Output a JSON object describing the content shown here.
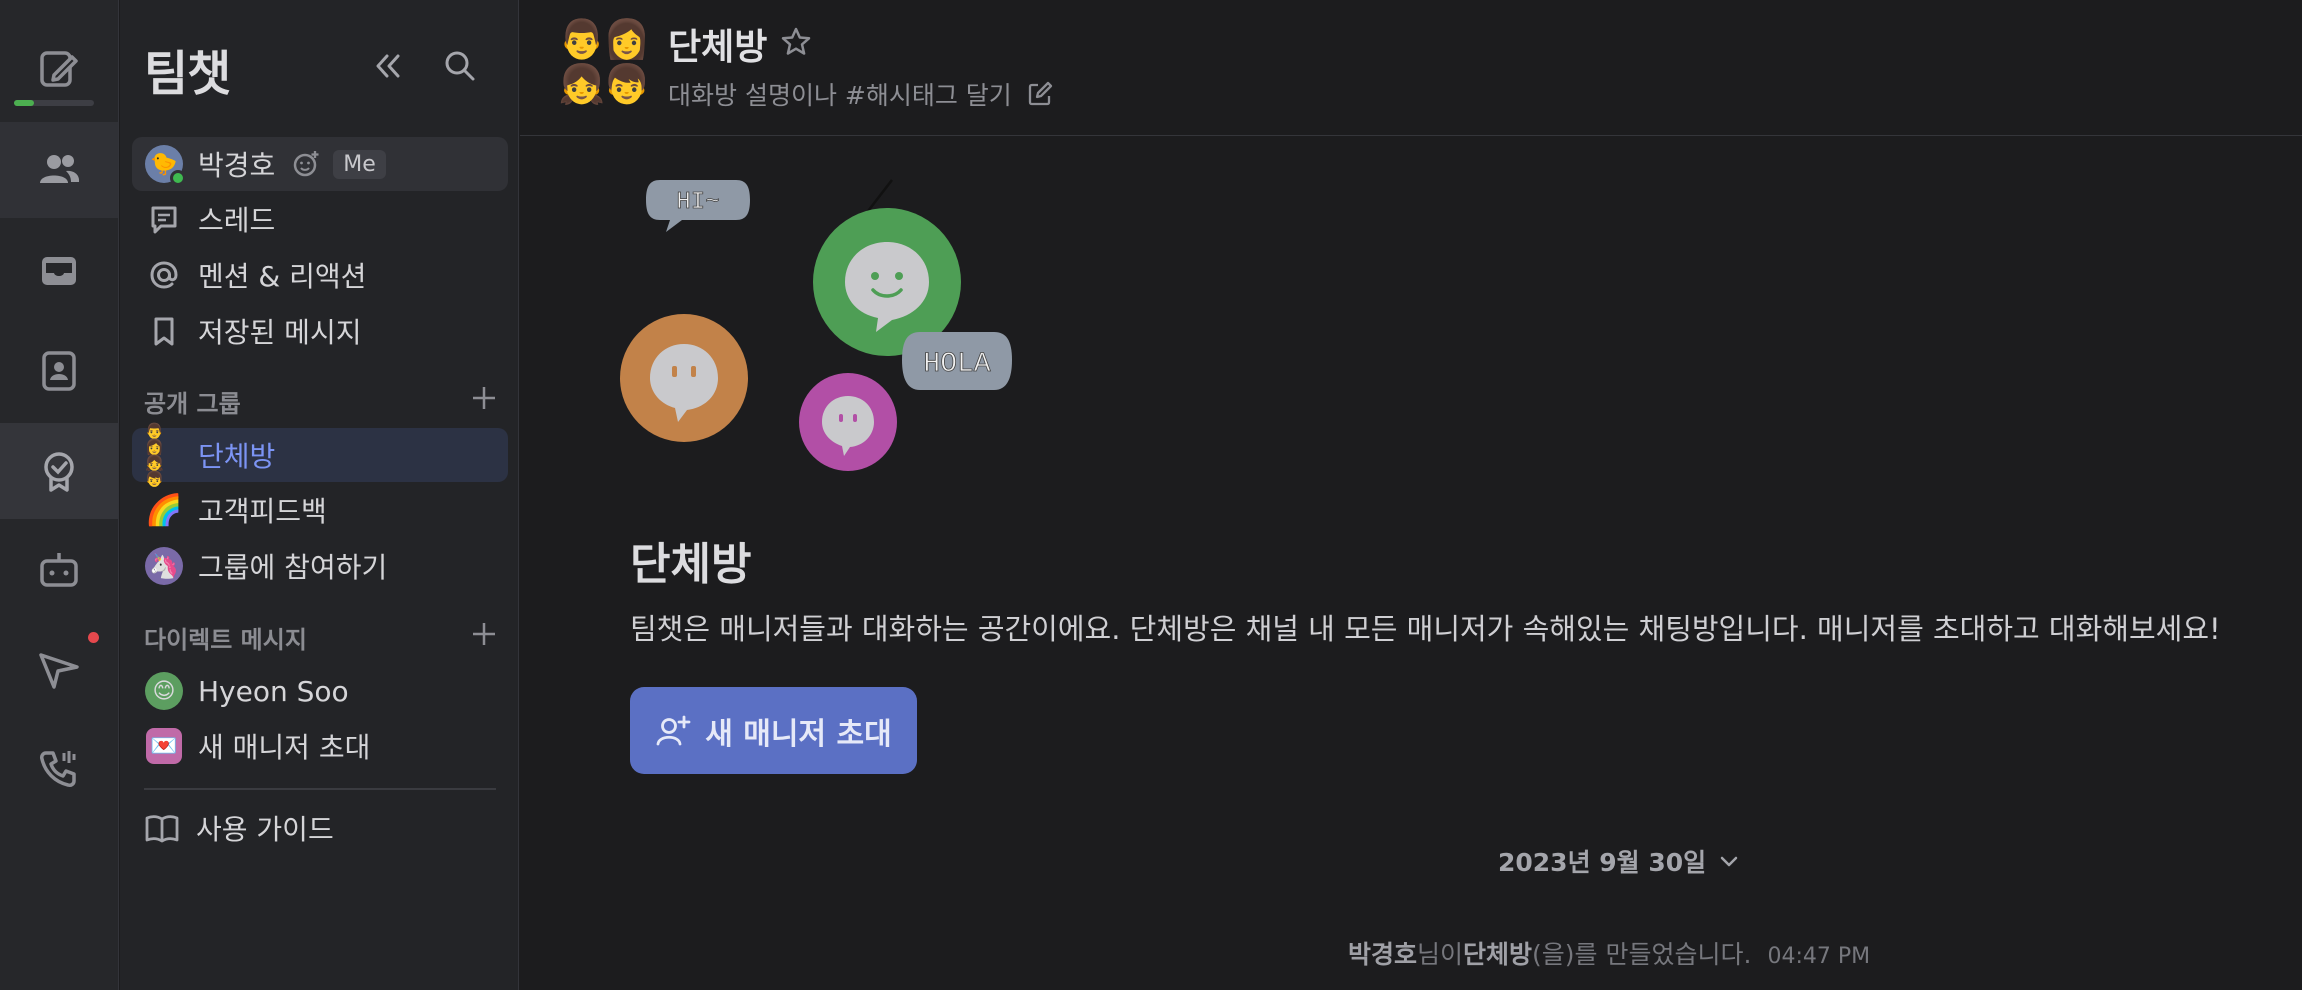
{
  "rail": {
    "progress_percent": 25,
    "items": [
      "compose",
      "team-chat",
      "inbox",
      "contacts",
      "badge",
      "bot",
      "send",
      "phone"
    ]
  },
  "sidebar": {
    "title": "팀챗",
    "me": {
      "name": "박경호",
      "badge": "Me"
    },
    "nav": [
      {
        "label": "스레드",
        "icon": "thread-icon"
      },
      {
        "label": "멘션 & 리액션",
        "icon": "at-icon"
      },
      {
        "label": "저장된 메시지",
        "icon": "bookmark-icon"
      }
    ],
    "public_groups": {
      "header": "공개 그룹",
      "items": [
        {
          "label": "단체방",
          "emoji": "👨👩👧👦",
          "selected": true
        },
        {
          "label": "고객피드백",
          "emoji": "🌈"
        },
        {
          "label": "그룹에 참여하기",
          "emoji": "🦄"
        }
      ]
    },
    "direct_messages": {
      "header": "다이렉트 메시지",
      "items": [
        {
          "label": "Hyeon Soo",
          "emoji": "😊"
        },
        {
          "label": "새 매니저 초대",
          "emoji": "💌"
        }
      ]
    },
    "guide_label": "사용 가이드"
  },
  "header": {
    "title": "단체방",
    "description": "대화방 설명이나 #해시태그 달기"
  },
  "main": {
    "illustration": {
      "bubble1": "HI~",
      "bubble2": "HOLA"
    },
    "room_title": "단체방",
    "room_description": "팀챗은 매니저들과 대화하는 공간이에요. 단체방은 채널 내 모든 매니저가 속해있는 채팅방입니다. 매니저를 초대하고 대화해보세요!",
    "invite_button": "새 매니저 초대",
    "date_label": "2023년 9월 30일",
    "system_message": {
      "actor": "박경호",
      "part1": "님이 ",
      "room": "단체방",
      "part2": "(을)를 만들었습니다.",
      "time": "04:47 PM"
    }
  },
  "colors": {
    "accent": "#5b70c4",
    "selected_text": "#7c94f4",
    "online": "#3fb950",
    "notification": "#e5484d"
  }
}
